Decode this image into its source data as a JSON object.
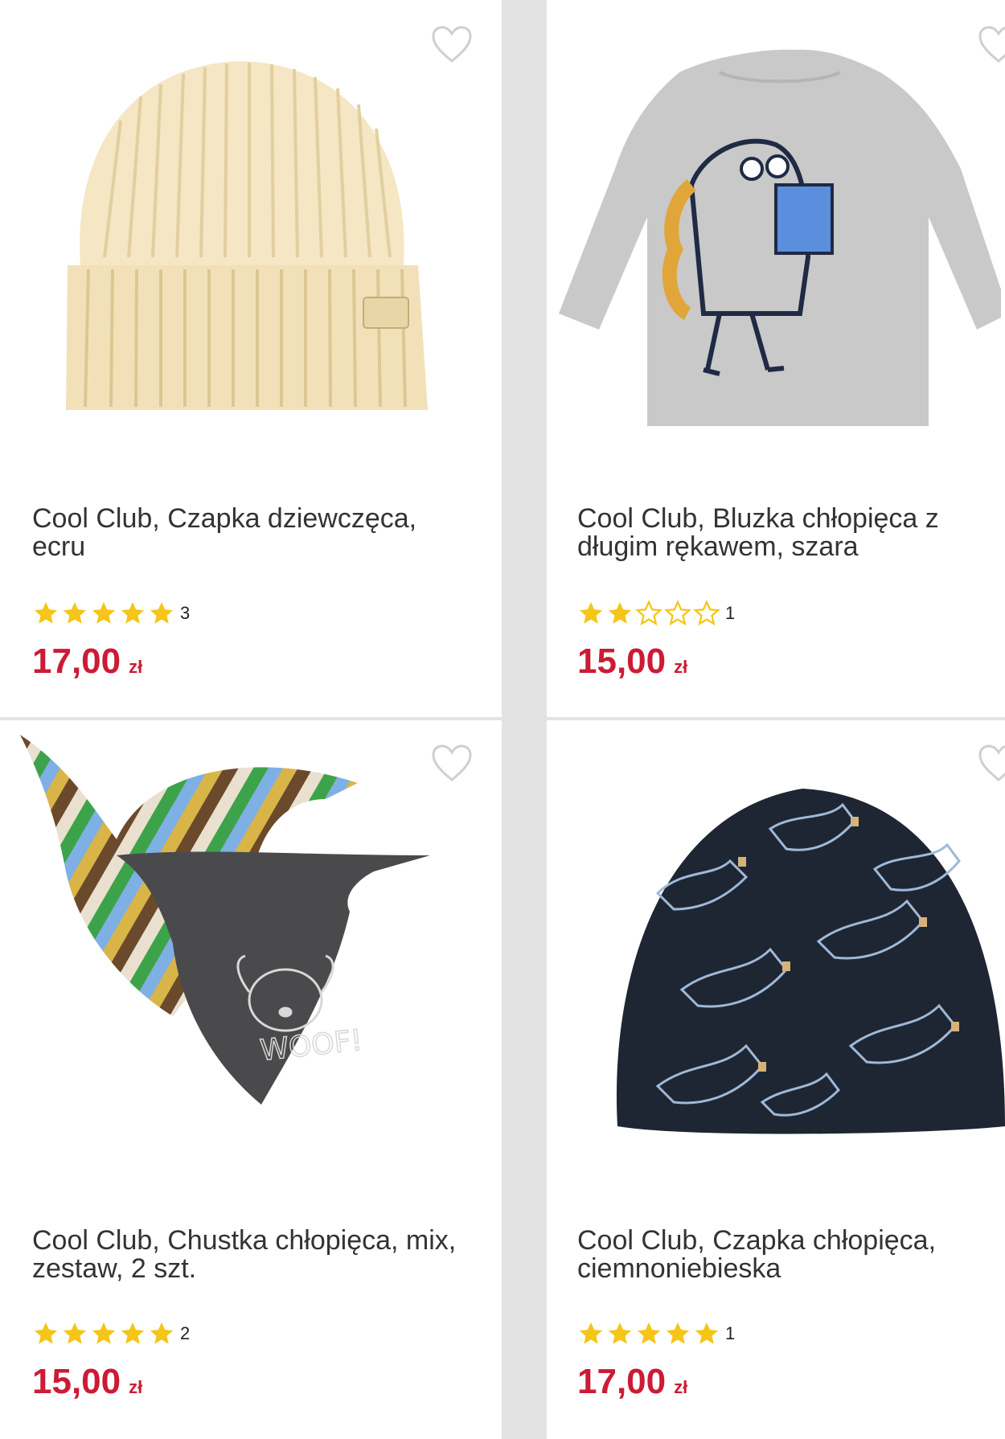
{
  "colors": {
    "price": "#cc1b34",
    "star": "#f5c518",
    "border": "#e3e3e3"
  },
  "products": [
    {
      "title": "Cool Club, Czapka dziewczęca, ecru",
      "rating": 5,
      "rating_count": "3",
      "price": "17,00",
      "currency": "zł",
      "image_icon": "beanie-ecru-image"
    },
    {
      "title": "Cool Club, Bluzka chłopięca z długim rękawem, szara",
      "rating": 2,
      "rating_count": "1",
      "price": "15,00",
      "currency": "zł",
      "image_icon": "grey-dino-shirt-image"
    },
    {
      "title": "Cool Club, Chustka chłopięca, mix, zestaw, 2 szt.",
      "rating": 5,
      "rating_count": "2",
      "price": "15,00",
      "currency": "zł",
      "image_icon": "bandanas-image",
      "image_text": "WOOF!"
    },
    {
      "title": "Cool Club, Czapka chłopięca, ciemnoniebieska",
      "rating": 5,
      "rating_count": "1",
      "price": "17,00",
      "currency": "zł",
      "image_icon": "navy-dino-beanie-image"
    }
  ]
}
